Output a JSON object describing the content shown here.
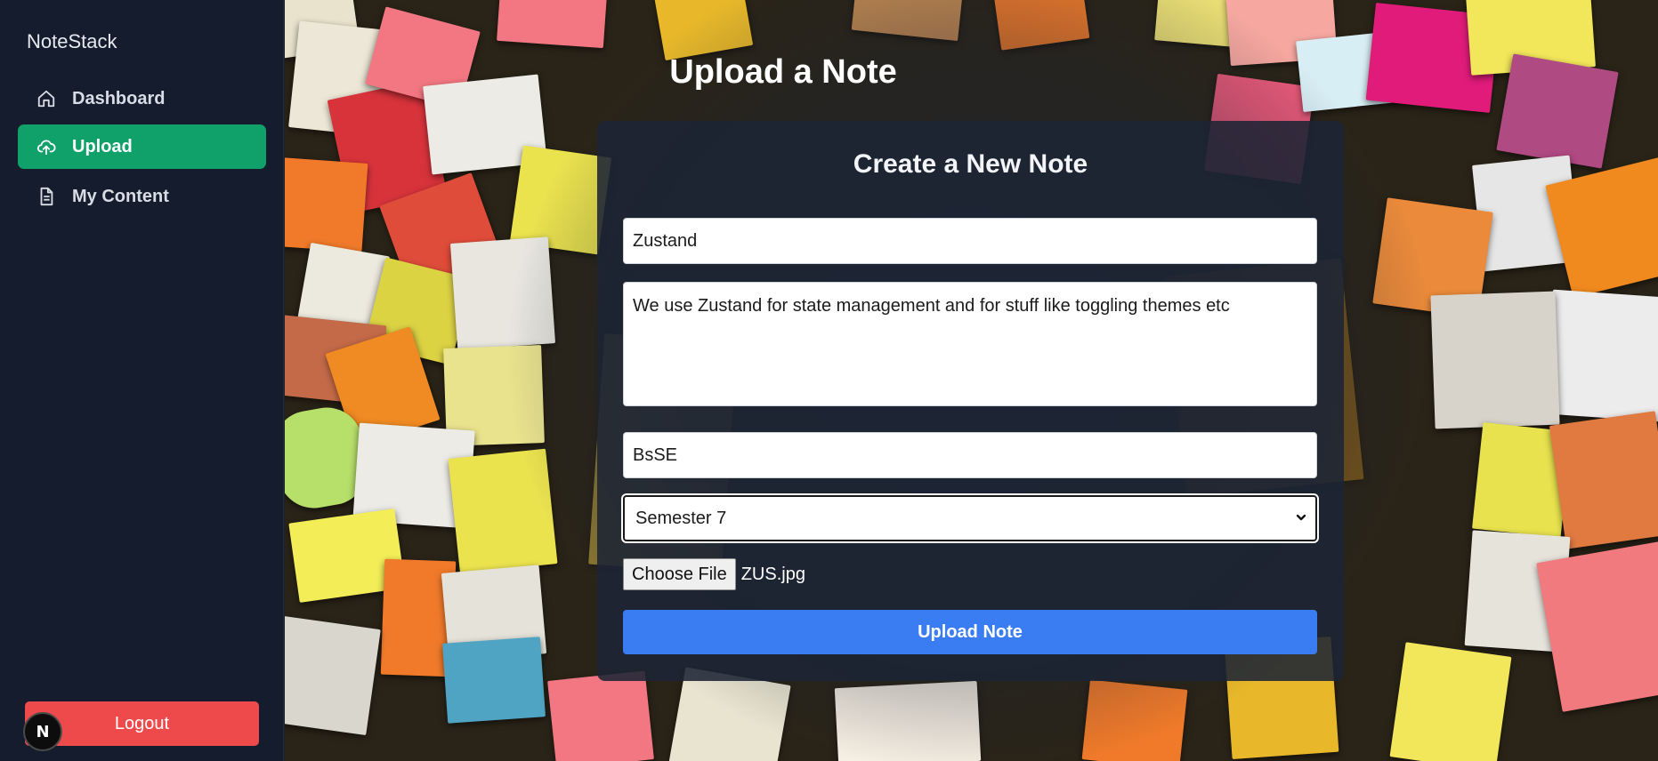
{
  "sidebar": {
    "brand": "NoteStack",
    "items": [
      {
        "label": "Dashboard",
        "icon": "home-icon"
      },
      {
        "label": "Upload",
        "icon": "cloud-upload-icon",
        "active": true
      },
      {
        "label": "My Content",
        "icon": "document-icon"
      }
    ],
    "logout_label": "Logout",
    "badge_letter": "N"
  },
  "page": {
    "title": "Upload a Note"
  },
  "form": {
    "heading": "Create a New Note",
    "title_value": "Zustand",
    "body_value": "We use Zustand for state management and for stuff like toggling themes etc",
    "course_value": "BsSE",
    "semester_value": "Semester 7",
    "choose_file_label": "Choose File",
    "file_name": "ZUS.jpg",
    "submit_label": "Upload Note"
  },
  "colors": {
    "sidebar_bg": "#141c2d",
    "active_nav": "#10a06a",
    "logout": "#ef4a4b",
    "primary_button": "#3a7cf1"
  }
}
